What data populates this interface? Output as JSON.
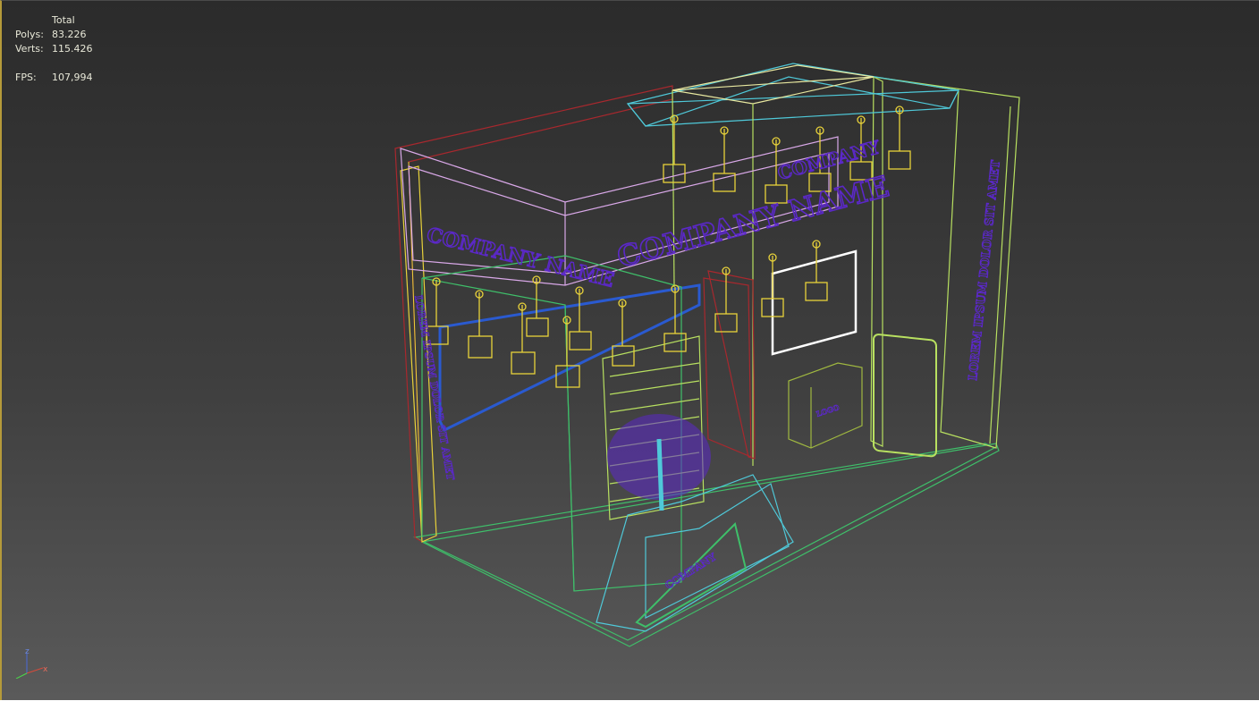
{
  "stats": {
    "header": "Total",
    "polys_label": "Polys:",
    "polys_value": "83.226",
    "verts_label": "Verts:",
    "verts_value": "115.426",
    "fps_label": "FPS:",
    "fps_value": "107,994"
  },
  "scene_text": {
    "company_left": "COMPANY NAME",
    "company_center": "COMPANY NAME",
    "company_top": "COMPANY",
    "lorem_right": "LOREM IPSUM DOLOR SIT AMET",
    "lorem_left": "LOREM IPSUM DOLOR SIT AMET",
    "counter_logo": "COMPANY",
    "small_logo": "LOGO"
  },
  "gizmo": {
    "x_label": "x",
    "z_label": "z"
  },
  "colors": {
    "viewport_top": "#2b2b2b",
    "viewport_bottom": "#5a5a5a",
    "wire_yellow": "#e8d23a",
    "wire_pink": "#d9a8e8",
    "wire_cyan": "#4fc9d9",
    "wire_green": "#3fbf6a",
    "wire_lime": "#b8e060",
    "wire_red": "#a8282e",
    "logo_purple": "#5b28c8",
    "accent_blue": "#2a5ad0"
  }
}
